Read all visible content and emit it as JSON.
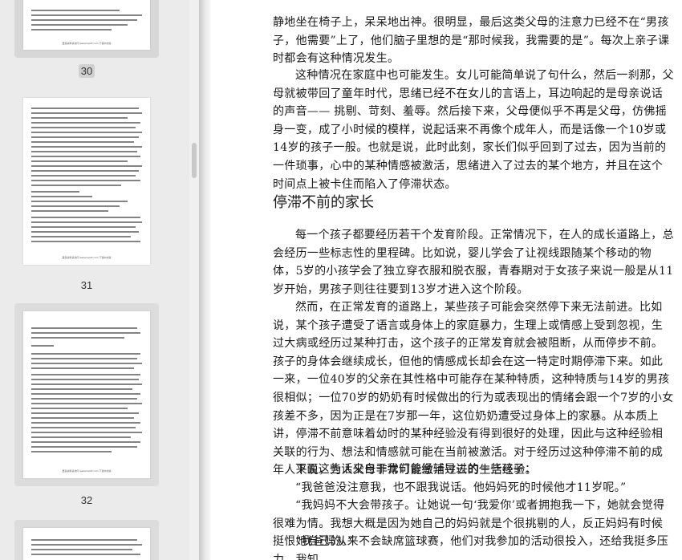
{
  "sidebar": {
    "thumbnails": [
      {
        "page": "30",
        "footer": "更多资料请访问 www.topdf.com 下载中文版"
      },
      {
        "page": "31",
        "footer": "更多资料请访问 www.topdf.com 下载中文版"
      },
      {
        "page": "32",
        "footer": "更多资料请访问 www.topdf.com 下载中文版"
      }
    ]
  },
  "document": {
    "para1": "静地坐在椅子上，呆呆地出神。很明显，最后这类父母的注意力已经不在“男孩子，他需要”上了，他们脑子里想的是“那时候我，我需要的是”。每次上亲子课时都会有这种情况发生。",
    "para2": "这种情况在家庭中也可能发生。女儿可能简单说了句什么，然后一刹那，父母就被带回了童年时代，思绪已经不在女儿的言语上，耳边响起的是母亲说话的声音—— 挑剔、苛刻、羞辱。然后接下来，父母便似乎不再是父母，仿佛摇身一变，成了小时候的模样，说起话来不再像个成年人，而是话像一个10岁或14岁的孩子一般。也就是说，此时此刻，家长们似乎回到了过去，因为当前的一件琐事，心中的某种情感被激活，思绪进入了过去的某个地方，并且在这个时间点上被卡住而陷入了停滞状态。",
    "heading": "停滞不前的家长",
    "para3": "每一个孩子都要经历若干个发育阶段。正常情况下，在人的成长道路上，总会经历一些标志性的里程碑。比如说，婴儿学会了让视线跟随某个移动的物体，5岁的小孩学会了独立穿衣服和脱衣服，青春期对于女孩子来说一般是从11岁开始，男孩子则往往要到13岁才进入这个阶段。",
    "para4": "然而，在正常发育的道路上，某些孩子可能会突然停下来无法前进。比如说，某个孩子遭受了语言或身体上的家庭暴力，生理上或情感上受到忽视，生过大病或经历过某种打击，这个孩子的正常发育就会被阻断，从而停步不前。孩子的身体会继续成长，但他的情感成长却会在这一特定时期停滞下来。如此一来，一位40岁的父亲在其性格中可能存在某种特质，这种特质与14岁的男孩很相似；一位70岁的奶奶有时候做出的行为或表现出的情绪会跟一个7岁的小女孩差不多，因为正是在7岁那一年，这位奶奶遭受过身体上的家暴。从本质上讲，停滞不前意味着幼时的某种经验没有得到很好的处理，因此与这种经验相关联的行为、想法和情感就可能在当前被激活。对于经历过这种停滞不前的成年人来说，为人父母非常可能激活过去的生活经验。",
    "para5": "下面这些话来自于我们曾经辅导过的一些孩子：",
    "quote1": "“我爸爸没注意我，也不跟我说话。他妈妈死的时候他才11岁呢。”",
    "quote2": "“我妈妈不大会带孩子。让她说一句‘我爱你’或者拥抱我一下，她就会觉得很难为情。我想大概是因为她自己的妈妈就是个很挑剔的人，反正妈妈有时候挺恨她自己的。”",
    "quote3": "“我爸妈从来不会缺席篮球赛，他们对我参加的活动很投入，还给我挺多压力。我知"
  }
}
